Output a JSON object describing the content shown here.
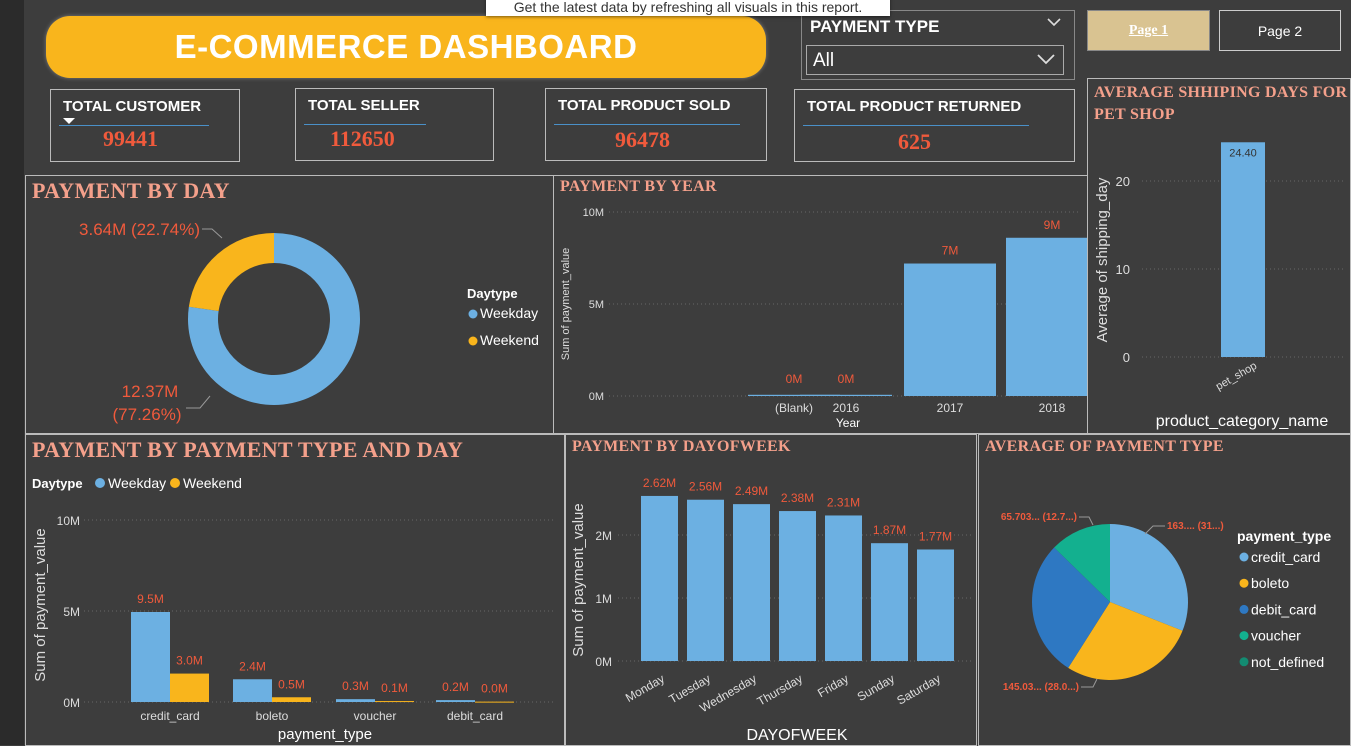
{
  "tooltip": "Get the latest data by refreshing all visuals in this report.",
  "dashboard_title": "E-COMMERCE DASHBOARD",
  "filter": {
    "title": "PAYMENT TYPE",
    "value": "All"
  },
  "pages": {
    "page1": "Page 1",
    "page2": "Page 2"
  },
  "kpis": {
    "customer": {
      "label": "TOTAL CUSTOMER",
      "value": "99441"
    },
    "seller": {
      "label": "TOTAL SELLER",
      "value": "112650"
    },
    "sold": {
      "label": "TOTAL PRODUCT SOLD",
      "value": "96478"
    },
    "returned": {
      "label": "TOTAL PRODUCT RETURNED",
      "value": "625"
    }
  },
  "colors": {
    "weekday": "#6cb0e2",
    "weekend": "#f9b51c",
    "label": "#f05a3c",
    "title": "#f4a08b",
    "debit": "#2e78c2",
    "voucher": "#13b08f",
    "not_defined": "#138c72"
  },
  "chart_data": [
    {
      "id": "payment_by_day",
      "type": "pie",
      "title": "PAYMENT BY DAY",
      "legend_title": "Daytype",
      "slices": [
        {
          "name": "Weekday",
          "value": 12.37,
          "label_value": "12.37M",
          "label_pct": "(77.26%)"
        },
        {
          "name": "Weekend",
          "value": 3.64,
          "label": "3.64M (22.74%)"
        }
      ]
    },
    {
      "id": "payment_by_year",
      "type": "bar",
      "title": "PAYMENT BY YEAR",
      "xlabel": "Year",
      "ylabel": "Sum of payment_value",
      "categories": [
        "(Blank)",
        "2016",
        "2017",
        "2018"
      ],
      "values": [
        0.001,
        0.05,
        7.2,
        8.6
      ],
      "labels": [
        "0M",
        "0M",
        "7M",
        "9M"
      ],
      "yticks": [
        "0M",
        "5M",
        "10M"
      ],
      "ylim": [
        0,
        10
      ]
    },
    {
      "id": "avg_shipping_pet",
      "type": "bar",
      "title": "AVERAGE SHHIPING DAYS FOR PET SHOP",
      "xlabel": "product_category_name",
      "ylabel": "Average of shipping_day",
      "categories": [
        "pet_shop"
      ],
      "values": [
        24.4
      ],
      "labels": [
        "24.40"
      ],
      "yticks": [
        "0",
        "10",
        "20"
      ],
      "ylim": [
        0,
        25
      ]
    },
    {
      "id": "payment_by_type_day",
      "type": "bar",
      "title": "PAYMENT BY PAYMENT TYPE AND DAY",
      "legend_title": "Daytype",
      "xlabel": "payment_type",
      "ylabel": "Sum of payment_value",
      "categories": [
        "credit_card",
        "boleto",
        "voucher",
        "debit_card"
      ],
      "series": [
        {
          "name": "Weekday",
          "values": [
            9.5,
            2.4,
            0.3,
            0.2
          ],
          "labels": [
            "9.5M",
            "2.4M",
            "0.3M",
            "0.2M"
          ]
        },
        {
          "name": "Weekend",
          "values": [
            3.0,
            0.5,
            0.1,
            0.04
          ],
          "labels": [
            "3.0M",
            "0.5M",
            "0.1M",
            "0.0M"
          ]
        }
      ],
      "yticks": [
        "0M",
        "5M",
        "10M"
      ],
      "ylim": [
        0,
        10
      ]
    },
    {
      "id": "payment_by_dayofweek",
      "type": "bar",
      "title": "PAYMENT BY DAYOFWEEK",
      "xlabel": "DAYOFWEEK",
      "ylabel": "Sum of payment_value",
      "categories": [
        "Monday",
        "Tuesday",
        "Wednesday",
        "Thursday",
        "Friday",
        "Sunday",
        "Saturday"
      ],
      "values": [
        2.62,
        2.56,
        2.49,
        2.38,
        2.31,
        1.87,
        1.77
      ],
      "labels": [
        "2.62M",
        "2.56M",
        "2.49M",
        "2.38M",
        "2.31M",
        "1.87M",
        "1.77M"
      ],
      "yticks": [
        "0M",
        "1M",
        "2M"
      ],
      "ylim": [
        0,
        2.7
      ]
    },
    {
      "id": "avg_payment_type",
      "type": "pie",
      "title": "AVERAGE OF PAYMENT TYPE",
      "legend_title": "payment_type",
      "legend": [
        "credit_card",
        "boleto",
        "debit_card",
        "voucher",
        "not_defined"
      ],
      "slices": [
        {
          "name": "credit_card",
          "value": 31,
          "label": "163.... (31...)"
        },
        {
          "name": "boleto",
          "value": 28,
          "label": "145.03... (28.0...)"
        },
        {
          "name": "debit_card",
          "value": 28.3
        },
        {
          "name": "voucher",
          "value": 12.7,
          "label": "65.703... (12.7...)"
        },
        {
          "name": "not_defined",
          "value": 0
        }
      ]
    }
  ]
}
